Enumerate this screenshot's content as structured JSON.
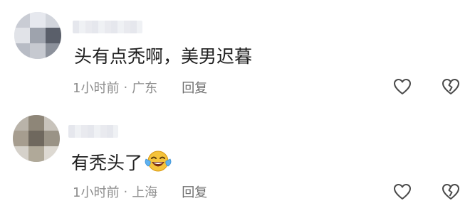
{
  "comments": [
    {
      "text": "头有点秃啊，美男迟暮",
      "time": "1小时前",
      "separator": "·",
      "location": "广东",
      "reply_label": "回复",
      "avatar_icon": "blurred-avatar",
      "username_icon": "blurred-username"
    },
    {
      "text": "有秃头了",
      "emoji": "laughing-crying-emoji",
      "time": "1小时前",
      "separator": "·",
      "location": "上海",
      "reply_label": "回复",
      "avatar_icon": "blurred-avatar",
      "username_icon": "blurred-username"
    }
  ],
  "icons": {
    "like": "heart-outline-icon",
    "dislike": "broken-heart-icon"
  },
  "colors": {
    "text": "#1f1f1f",
    "meta": "#8d8d8d",
    "reply": "#6f6f6f",
    "icon": "#4a4a4a"
  }
}
